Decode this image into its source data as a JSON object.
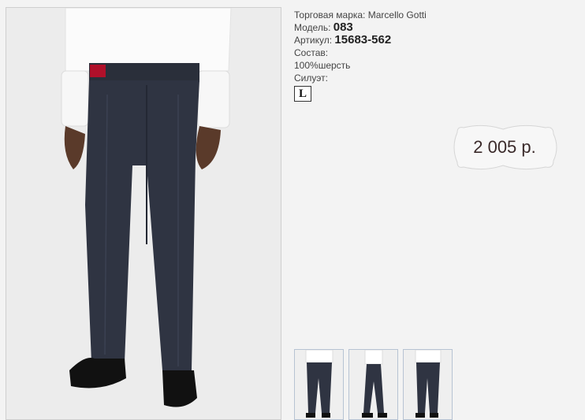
{
  "product": {
    "brand_label": "Торговая марка:",
    "brand_value": "Marcello Gotti",
    "model_label": "Модель:",
    "model_value": "083",
    "article_label": "Артикул:",
    "article_value": "15683-562",
    "composition_label": "Состав:",
    "composition_value": "100%шерсть",
    "silhouette_label": "Силуэт:",
    "silhouette_value": "L"
  },
  "price": {
    "value": "2 005 р."
  },
  "images": {
    "main": "trousers-front-photo",
    "thumbnails": [
      "trousers-front-thumb",
      "trousers-side-thumb",
      "trousers-back-thumb"
    ]
  }
}
